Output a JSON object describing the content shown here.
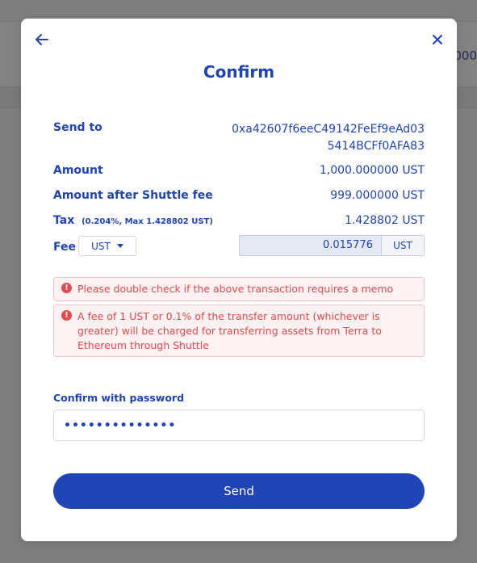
{
  "background": {
    "partial_text": "000"
  },
  "modal": {
    "title": "Confirm",
    "send_to": {
      "label": "Send to",
      "line1": "0xa42607f6eeC49142FeEf9eAd03",
      "line2": "5414BCFf0AFA83"
    },
    "amount": {
      "label": "Amount",
      "value": "1,000.000000 UST"
    },
    "amount_after_fee": {
      "label": "Amount after Shuttle fee",
      "value": "999.000000 UST"
    },
    "tax": {
      "label": "Tax",
      "note": "(0.204%, Max 1.428802 UST)",
      "value": "1.428802 UST"
    },
    "fee": {
      "label": "Fee",
      "denom_selected": "UST",
      "value": "0.015776",
      "unit": "UST"
    },
    "alerts": [
      "Please double check if the above transaction requires a memo",
      "A fee of 1 UST or 0.1% of the transfer amount (whichever is greater) will be charged for transferring assets from Terra to Ethereum through Shuttle"
    ],
    "password": {
      "label": "Confirm with password",
      "masked_value": "••••••••••••••"
    },
    "send_label": "Send"
  },
  "colors": {
    "accent": "#2043b5",
    "error": "#e5484d",
    "error_bg": "#fdf1f1"
  },
  "icons": {
    "back": "arrow-left-icon",
    "close": "close-icon",
    "dropdown": "caret-down-icon",
    "alert": "exclamation-circle-icon"
  }
}
